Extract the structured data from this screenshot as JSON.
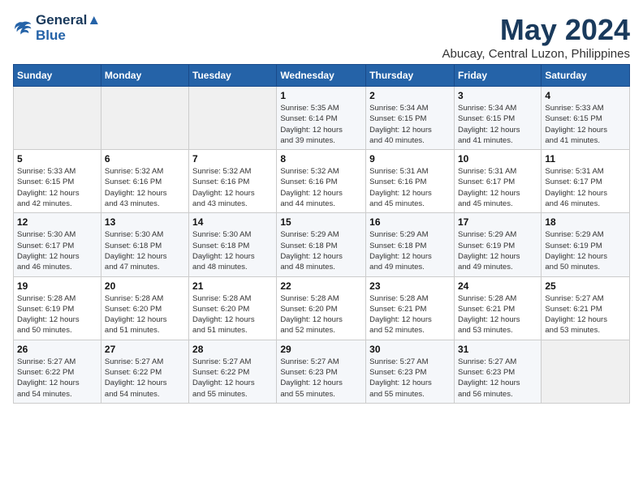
{
  "header": {
    "logo_line1": "General",
    "logo_line2": "Blue",
    "month_title": "May 2024",
    "location": "Abucay, Central Luzon, Philippines"
  },
  "weekdays": [
    "Sunday",
    "Monday",
    "Tuesday",
    "Wednesday",
    "Thursday",
    "Friday",
    "Saturday"
  ],
  "weeks": [
    [
      {
        "day": "",
        "detail": ""
      },
      {
        "day": "",
        "detail": ""
      },
      {
        "day": "",
        "detail": ""
      },
      {
        "day": "1",
        "detail": "Sunrise: 5:35 AM\nSunset: 6:14 PM\nDaylight: 12 hours\nand 39 minutes."
      },
      {
        "day": "2",
        "detail": "Sunrise: 5:34 AM\nSunset: 6:15 PM\nDaylight: 12 hours\nand 40 minutes."
      },
      {
        "day": "3",
        "detail": "Sunrise: 5:34 AM\nSunset: 6:15 PM\nDaylight: 12 hours\nand 41 minutes."
      },
      {
        "day": "4",
        "detail": "Sunrise: 5:33 AM\nSunset: 6:15 PM\nDaylight: 12 hours\nand 41 minutes."
      }
    ],
    [
      {
        "day": "5",
        "detail": "Sunrise: 5:33 AM\nSunset: 6:15 PM\nDaylight: 12 hours\nand 42 minutes."
      },
      {
        "day": "6",
        "detail": "Sunrise: 5:32 AM\nSunset: 6:16 PM\nDaylight: 12 hours\nand 43 minutes."
      },
      {
        "day": "7",
        "detail": "Sunrise: 5:32 AM\nSunset: 6:16 PM\nDaylight: 12 hours\nand 43 minutes."
      },
      {
        "day": "8",
        "detail": "Sunrise: 5:32 AM\nSunset: 6:16 PM\nDaylight: 12 hours\nand 44 minutes."
      },
      {
        "day": "9",
        "detail": "Sunrise: 5:31 AM\nSunset: 6:16 PM\nDaylight: 12 hours\nand 45 minutes."
      },
      {
        "day": "10",
        "detail": "Sunrise: 5:31 AM\nSunset: 6:17 PM\nDaylight: 12 hours\nand 45 minutes."
      },
      {
        "day": "11",
        "detail": "Sunrise: 5:31 AM\nSunset: 6:17 PM\nDaylight: 12 hours\nand 46 minutes."
      }
    ],
    [
      {
        "day": "12",
        "detail": "Sunrise: 5:30 AM\nSunset: 6:17 PM\nDaylight: 12 hours\nand 46 minutes."
      },
      {
        "day": "13",
        "detail": "Sunrise: 5:30 AM\nSunset: 6:18 PM\nDaylight: 12 hours\nand 47 minutes."
      },
      {
        "day": "14",
        "detail": "Sunrise: 5:30 AM\nSunset: 6:18 PM\nDaylight: 12 hours\nand 48 minutes."
      },
      {
        "day": "15",
        "detail": "Sunrise: 5:29 AM\nSunset: 6:18 PM\nDaylight: 12 hours\nand 48 minutes."
      },
      {
        "day": "16",
        "detail": "Sunrise: 5:29 AM\nSunset: 6:18 PM\nDaylight: 12 hours\nand 49 minutes."
      },
      {
        "day": "17",
        "detail": "Sunrise: 5:29 AM\nSunset: 6:19 PM\nDaylight: 12 hours\nand 49 minutes."
      },
      {
        "day": "18",
        "detail": "Sunrise: 5:29 AM\nSunset: 6:19 PM\nDaylight: 12 hours\nand 50 minutes."
      }
    ],
    [
      {
        "day": "19",
        "detail": "Sunrise: 5:28 AM\nSunset: 6:19 PM\nDaylight: 12 hours\nand 50 minutes."
      },
      {
        "day": "20",
        "detail": "Sunrise: 5:28 AM\nSunset: 6:20 PM\nDaylight: 12 hours\nand 51 minutes."
      },
      {
        "day": "21",
        "detail": "Sunrise: 5:28 AM\nSunset: 6:20 PM\nDaylight: 12 hours\nand 51 minutes."
      },
      {
        "day": "22",
        "detail": "Sunrise: 5:28 AM\nSunset: 6:20 PM\nDaylight: 12 hours\nand 52 minutes."
      },
      {
        "day": "23",
        "detail": "Sunrise: 5:28 AM\nSunset: 6:21 PM\nDaylight: 12 hours\nand 52 minutes."
      },
      {
        "day": "24",
        "detail": "Sunrise: 5:28 AM\nSunset: 6:21 PM\nDaylight: 12 hours\nand 53 minutes."
      },
      {
        "day": "25",
        "detail": "Sunrise: 5:27 AM\nSunset: 6:21 PM\nDaylight: 12 hours\nand 53 minutes."
      }
    ],
    [
      {
        "day": "26",
        "detail": "Sunrise: 5:27 AM\nSunset: 6:22 PM\nDaylight: 12 hours\nand 54 minutes."
      },
      {
        "day": "27",
        "detail": "Sunrise: 5:27 AM\nSunset: 6:22 PM\nDaylight: 12 hours\nand 54 minutes."
      },
      {
        "day": "28",
        "detail": "Sunrise: 5:27 AM\nSunset: 6:22 PM\nDaylight: 12 hours\nand 55 minutes."
      },
      {
        "day": "29",
        "detail": "Sunrise: 5:27 AM\nSunset: 6:23 PM\nDaylight: 12 hours\nand 55 minutes."
      },
      {
        "day": "30",
        "detail": "Sunrise: 5:27 AM\nSunset: 6:23 PM\nDaylight: 12 hours\nand 55 minutes."
      },
      {
        "day": "31",
        "detail": "Sunrise: 5:27 AM\nSunset: 6:23 PM\nDaylight: 12 hours\nand 56 minutes."
      },
      {
        "day": "",
        "detail": ""
      }
    ]
  ]
}
